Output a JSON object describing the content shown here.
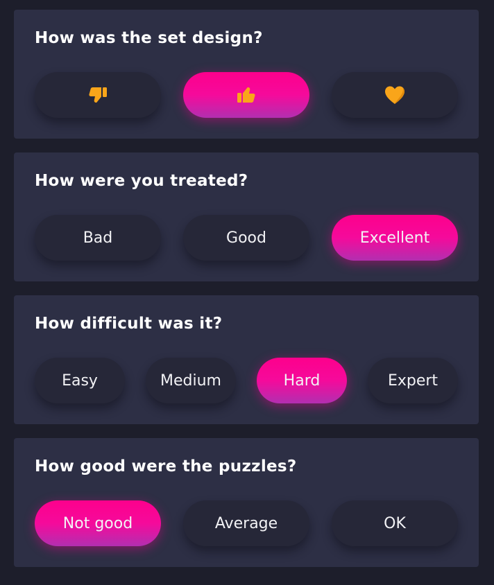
{
  "colors": {
    "page_bg": "#1d1e2b",
    "card_bg": "#2d2f45",
    "option_bg": "#262738",
    "selected_gradient": [
      "#fd008c",
      "#b22fb0"
    ],
    "icon": "#f9a51a"
  },
  "questions": [
    {
      "title": "How was the set design?",
      "options": [
        {
          "icon": "thumbs-down-icon",
          "selected": false
        },
        {
          "icon": "thumbs-up-icon",
          "selected": true
        },
        {
          "icon": "heart-icon",
          "selected": false
        }
      ]
    },
    {
      "title": "How were you treated?",
      "options": [
        {
          "label": "Bad",
          "selected": false
        },
        {
          "label": "Good",
          "selected": false
        },
        {
          "label": "Excellent",
          "selected": true
        }
      ]
    },
    {
      "title": "How difficult was it?",
      "options": [
        {
          "label": "Easy",
          "selected": false
        },
        {
          "label": "Medium",
          "selected": false
        },
        {
          "label": "Hard",
          "selected": true
        },
        {
          "label": "Expert",
          "selected": false
        }
      ]
    },
    {
      "title": "How good were the puzzles?",
      "options": [
        {
          "label": "Not good",
          "selected": true
        },
        {
          "label": "Average",
          "selected": false
        },
        {
          "label": "OK",
          "selected": false
        }
      ]
    }
  ]
}
